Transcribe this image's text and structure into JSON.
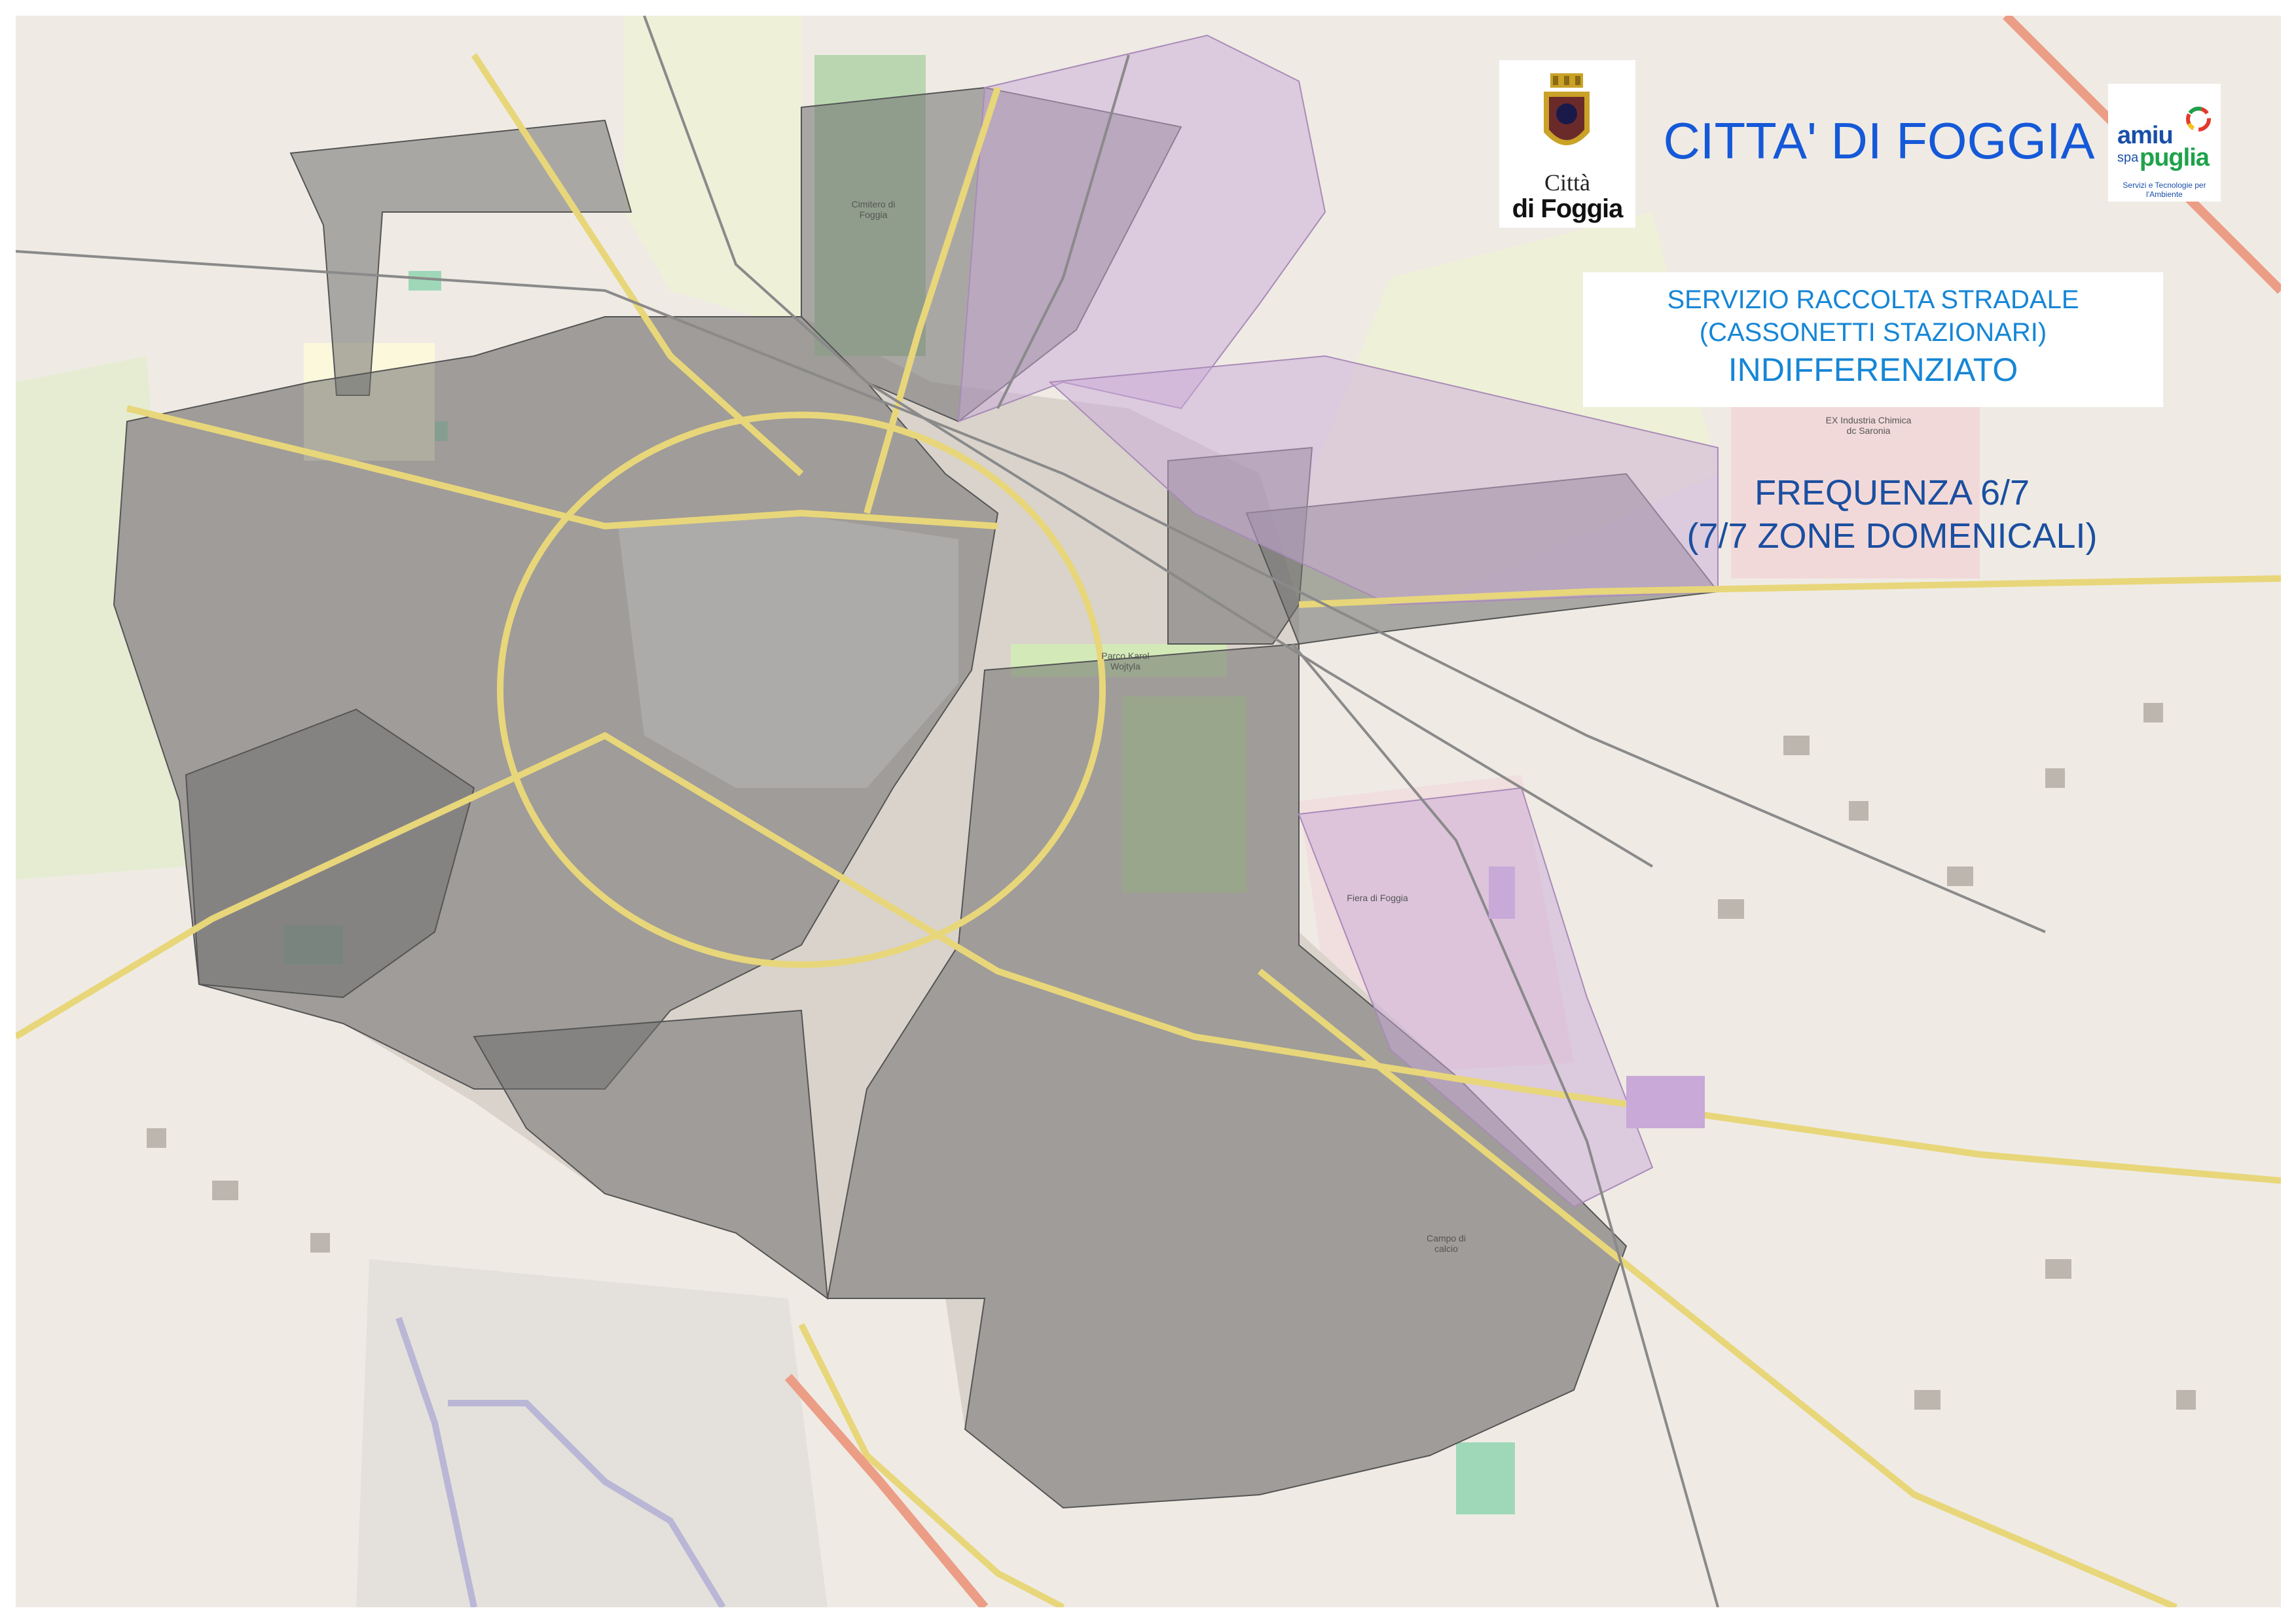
{
  "header": {
    "title": "CITTA' DI FOGGIA"
  },
  "city_logo": {
    "name_line1": "Città",
    "name_line2": "di Foggia"
  },
  "operator_logo": {
    "brand_left": "amiu",
    "brand_small": "spa",
    "brand_right": "puglia",
    "tagline": "Servizi e Tecnologie per l'Ambiente"
  },
  "service": {
    "line1": "SERVIZIO RACCOLTA STRADALE",
    "line2": "(CASSONETTI STAZIONARI)",
    "line3": "INDIFFERENZIATO"
  },
  "frequency": {
    "line1": "FREQUENZA 6/7",
    "line2": "(7/7 ZONE DOMENICALI)"
  },
  "map_labels": {
    "cemetery": "Cimitero di Foggia",
    "industry": "EX Industria Chimica dc Saronia",
    "fair": "Fiera di Foggia",
    "park": "Parco Karol Wojtyla",
    "campo": "Campo di calcio"
  },
  "colors": {
    "title": "#1559d8",
    "service_text": "#1686d6",
    "frequency_text": "#1b4fa0",
    "zone_fill_gray": "#6f6f6f",
    "zone_fill_purple": "#c9a9d8",
    "map_background": "#efebe4"
  }
}
